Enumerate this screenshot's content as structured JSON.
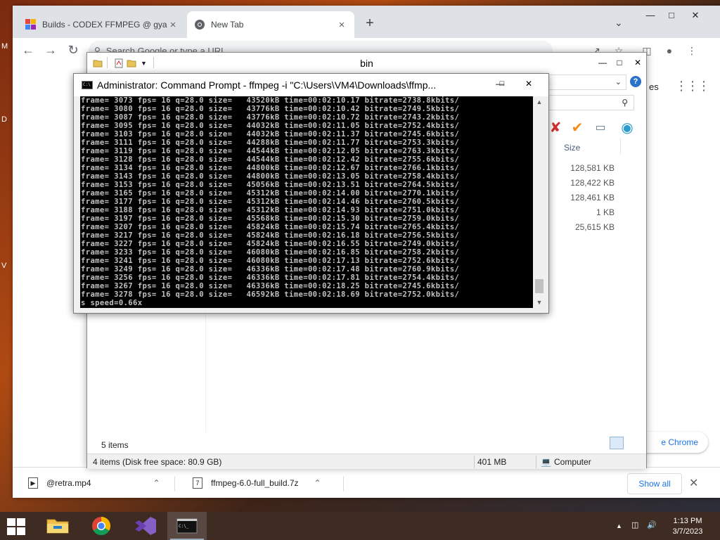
{
  "desktop": {
    "icon_letters": [
      "M",
      "D",
      "V"
    ]
  },
  "browser": {
    "tabs": [
      {
        "title": "Builds - CODEX FFMPEG @ gyan.dev",
        "favicon": "codex-favicon"
      },
      {
        "title": "New Tab",
        "favicon": "chrome-favicon"
      }
    ],
    "omnibox_placeholder": "Search Google or type a URL",
    "ntp": {
      "link_fragment": "es",
      "customize_chip": "e Chrome"
    },
    "downloads": [
      {
        "name": "@retra.mp4",
        "icon": "video-file-icon"
      },
      {
        "name": "ffmpeg-6.0-full_build.7z",
        "icon": "archive-file-icon"
      }
    ],
    "show_all": "Show all"
  },
  "explorer": {
    "title": "bin",
    "column_size": "Size",
    "sizes": [
      "128,581 KB",
      "128,422 KB",
      "128,461 KB",
      "1 KB",
      "25,615 KB"
    ],
    "items_count": "5 items",
    "status_text": "4 items (Disk free space: 80.9 GB)",
    "status_size": "401 MB",
    "status_location": "Computer"
  },
  "cmd": {
    "title": "Administrator:  Command Prompt - ffmpeg  -i \"C:\\Users\\VM4\\Downloads\\ffmp...",
    "icon_text": "C:\\",
    "lines": [
      "frame= 3073 fps= 16 q=28.0 size=   43520kB time=00:02:10.17 bitrate=2738.8kbits/",
      "frame= 3080 fps= 16 q=28.0 size=   43776kB time=00:02:10.42 bitrate=2749.5kbits/",
      "frame= 3087 fps= 16 q=28.0 size=   43776kB time=00:02:10.72 bitrate=2743.2kbits/",
      "frame= 3095 fps= 16 q=28.0 size=   44032kB time=00:02:11.05 bitrate=2752.4kbits/",
      "frame= 3103 fps= 16 q=28.0 size=   44032kB time=00:02:11.37 bitrate=2745.6kbits/",
      "frame= 3111 fps= 16 q=28.0 size=   44288kB time=00:02:11.77 bitrate=2753.3kbits/",
      "frame= 3119 fps= 16 q=28.0 size=   44544kB time=00:02:12.05 bitrate=2763.3kbits/",
      "frame= 3128 fps= 16 q=28.0 size=   44544kB time=00:02:12.42 bitrate=2755.6kbits/",
      "frame= 3134 fps= 16 q=28.0 size=   44800kB time=00:02:12.67 bitrate=2766.1kbits/",
      "frame= 3143 fps= 16 q=28.0 size=   44800kB time=00:02:13.05 bitrate=2758.4kbits/",
      "frame= 3153 fps= 16 q=28.0 size=   45056kB time=00:02:13.51 bitrate=2764.5kbits/",
      "frame= 3165 fps= 16 q=28.0 size=   45312kB time=00:02:14.00 bitrate=2770.1kbits/",
      "frame= 3177 fps= 16 q=28.0 size=   45312kB time=00:02:14.46 bitrate=2760.5kbits/",
      "frame= 3188 fps= 16 q=28.0 size=   45312kB time=00:02:14.93 bitrate=2751.0kbits/",
      "frame= 3197 fps= 16 q=28.0 size=   45568kB time=00:02:15.30 bitrate=2759.0kbits/",
      "frame= 3207 fps= 16 q=28.0 size=   45824kB time=00:02:15.74 bitrate=2765.4kbits/",
      "frame= 3217 fps= 16 q=28.0 size=   45824kB time=00:02:16.18 bitrate=2756.5kbits/",
      "frame= 3227 fps= 16 q=28.0 size=   45824kB time=00:02:16.55 bitrate=2749.0kbits/",
      "frame= 3233 fps= 16 q=28.0 size=   46080kB time=00:02:16.85 bitrate=2758.2kbits/",
      "frame= 3241 fps= 16 q=28.0 size=   46080kB time=00:02:17.13 bitrate=2752.6kbits/",
      "frame= 3249 fps= 16 q=28.0 size=   46336kB time=00:02:17.48 bitrate=2760.9kbits/",
      "frame= 3256 fps= 16 q=28.0 size=   46336kB time=00:02:17.81 bitrate=2754.4kbits/",
      "frame= 3267 fps= 16 q=28.0 size=   46336kB time=00:02:18.25 bitrate=2745.6kbits/",
      "frame= 3278 fps= 16 q=28.0 size=   46592kB time=00:02:18.69 bitrate=2752.0kbits/",
      "s speed=0.66x"
    ]
  },
  "taskbar": {
    "apps": [
      "file-explorer-icon",
      "chrome-icon",
      "visual-studio-icon",
      "command-prompt-icon"
    ],
    "active_app": "command-prompt-icon",
    "time": "1:13 PM",
    "date": "3/7/2023"
  },
  "colors": {
    "chrome_tabstrip": "#dee1e6",
    "link_blue": "#1a73e8",
    "console_bg": "#000000",
    "console_text": "#c0c0c0",
    "taskbar": "#3e2b22"
  }
}
